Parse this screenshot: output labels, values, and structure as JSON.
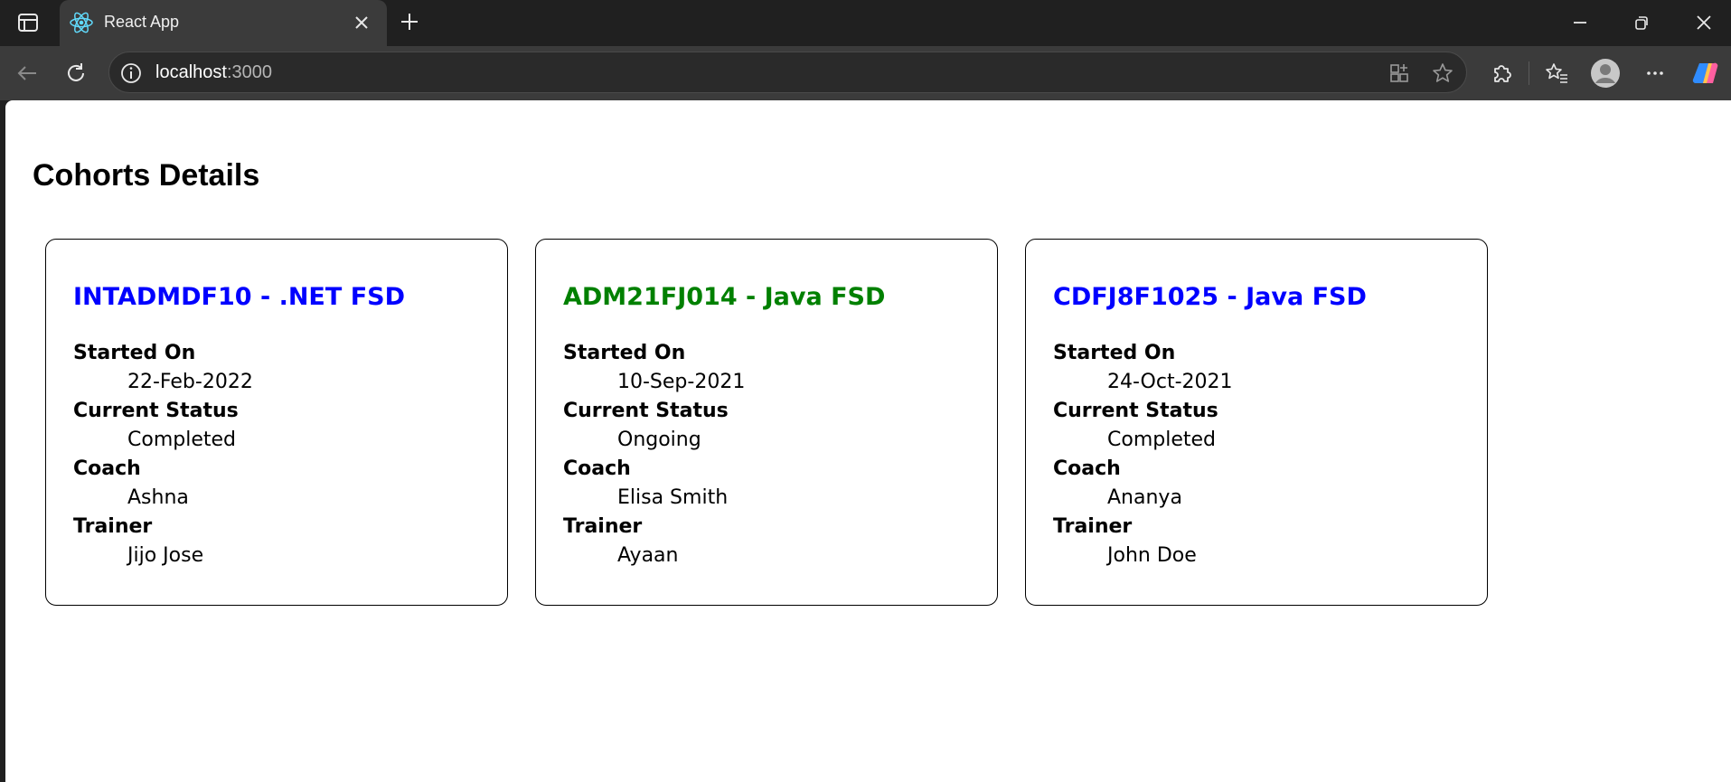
{
  "browser": {
    "tab_title": "React App",
    "url_host": "localhost",
    "url_port": ":3000"
  },
  "page": {
    "title": "Cohorts Details"
  },
  "cohorts": [
    {
      "title": "INTADMDF10 - .NET FSD",
      "title_color": "#0000ff",
      "started_on_label": "Started On",
      "started_on": "22-Feb-2022",
      "status_label": "Current Status",
      "status": "Completed",
      "coach_label": "Coach",
      "coach": "Ashna",
      "trainer_label": "Trainer",
      "trainer": "Jijo Jose"
    },
    {
      "title": "ADM21FJ014 - Java FSD",
      "title_color": "#008000",
      "started_on_label": "Started On",
      "started_on": "10-Sep-2021",
      "status_label": "Current Status",
      "status": "Ongoing",
      "coach_label": "Coach",
      "coach": "Elisa Smith",
      "trainer_label": "Trainer",
      "trainer": "Ayaan"
    },
    {
      "title": "CDFJ8F1025 - Java FSD",
      "title_color": "#0000ff",
      "started_on_label": "Started On",
      "started_on": "24-Oct-2021",
      "status_label": "Current Status",
      "status": "Completed",
      "coach_label": "Coach",
      "coach": "Ananya",
      "trainer_label": "Trainer",
      "trainer": "John Doe"
    }
  ],
  "icons": {
    "sidebar": "sidebar-toggle-icon",
    "favicon": "react-logo-icon",
    "close_tab": "close-icon",
    "new_tab": "plus-icon",
    "minimize": "minimize-icon",
    "restore": "restore-icon",
    "close_window": "close-icon",
    "back": "back-arrow-icon",
    "refresh": "refresh-icon",
    "info": "info-icon",
    "app": "app-available-icon",
    "favorite": "star-icon",
    "extensions": "puzzle-icon",
    "favorites": "favorites-icon",
    "profile": "profile-icon",
    "more": "more-icon",
    "copilot": "copilot-icon"
  }
}
